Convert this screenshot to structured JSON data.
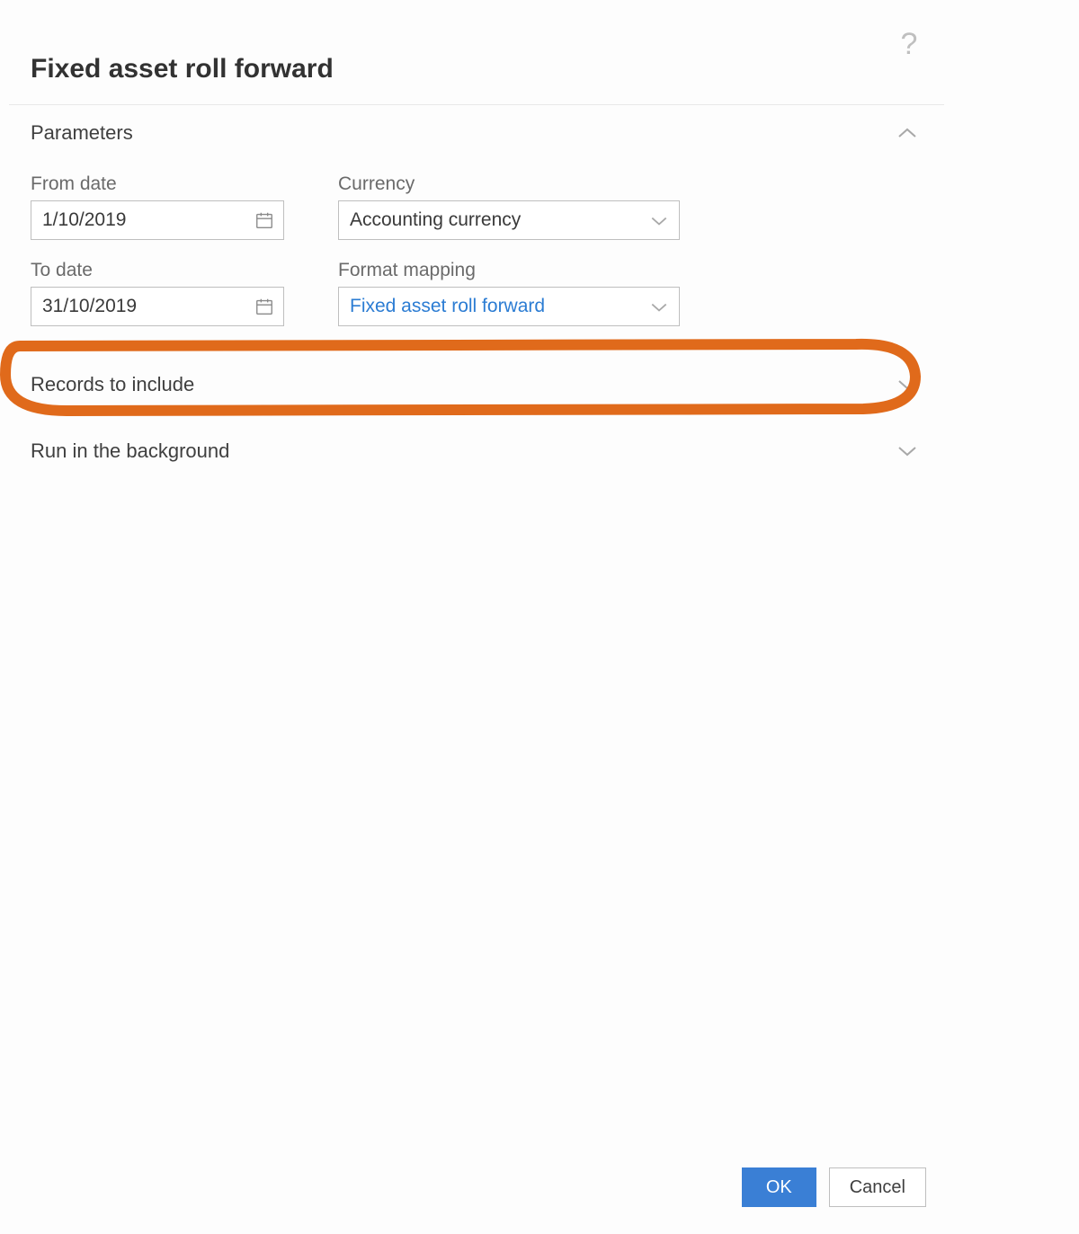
{
  "title": "Fixed asset roll forward",
  "sections": {
    "parameters": {
      "label": "Parameters",
      "fields": {
        "from_date": {
          "label": "From date",
          "value": "1/10/2019"
        },
        "to_date": {
          "label": "To date",
          "value": "31/10/2019"
        },
        "currency": {
          "label": "Currency",
          "value": "Accounting currency"
        },
        "format_mapping": {
          "label": "Format mapping",
          "value": "Fixed asset roll forward"
        }
      }
    },
    "records": {
      "label": "Records to include"
    },
    "background": {
      "label": "Run in the background"
    }
  },
  "footer": {
    "ok": "OK",
    "cancel": "Cancel"
  },
  "annotation": {
    "color": "#e06a1b"
  }
}
